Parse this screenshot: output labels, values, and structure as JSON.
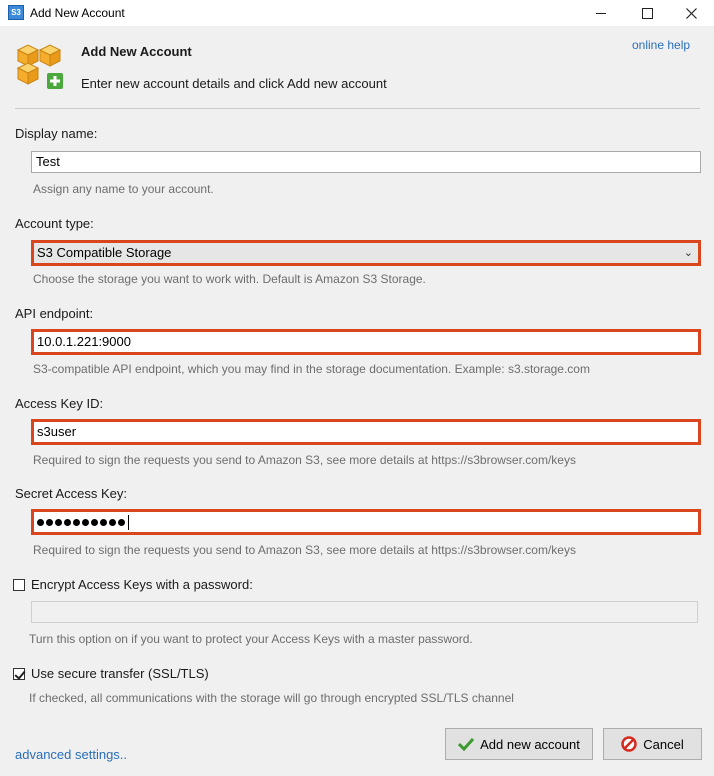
{
  "window": {
    "title": "Add New Account",
    "app_icon_text": "S3"
  },
  "header": {
    "title": "Add New Account",
    "subtitle": "Enter new account details and click Add new account",
    "help_link": "online help"
  },
  "display_name": {
    "label": "Display name:",
    "value": "Test",
    "hint": "Assign any name to your account."
  },
  "account_type": {
    "label": "Account type:",
    "value": "S3 Compatible Storage",
    "hint": "Choose the storage you want to work with. Default is Amazon S3 Storage."
  },
  "api_endpoint": {
    "label": "API endpoint:",
    "value": "10.0.1.221:9000",
    "hint": "S3-compatible API endpoint, which you may find in the storage documentation. Example: s3.storage.com"
  },
  "access_key": {
    "label": "Access Key ID:",
    "value": "s3user",
    "hint": "Required to sign the requests you send to Amazon S3, see more details at https://s3browser.com/keys"
  },
  "secret_key": {
    "label": "Secret Access Key:",
    "masked_length": 10,
    "hint": "Required to sign the requests you send to Amazon S3, see more details at https://s3browser.com/keys"
  },
  "encrypt": {
    "label": "Encrypt Access Keys with a password:",
    "checked": false,
    "hint": "Turn this option on if you want to protect your Access Keys with a master password."
  },
  "secure": {
    "label": "Use secure transfer (SSL/TLS)",
    "checked": true,
    "hint": "If checked, all communications with the storage will go through encrypted SSL/TLS channel"
  },
  "footer": {
    "advanced_link": "advanced settings..",
    "add_button": "Add new account",
    "cancel_button": "Cancel"
  },
  "colors": {
    "highlight": "#d9461e",
    "link": "#2a6fb8",
    "hint": "#6d6d6d"
  },
  "icons": [
    "s3-app-icon",
    "cubes-add-icon",
    "minimize-icon",
    "maximize-icon",
    "close-icon",
    "chevron-down-icon",
    "checkmark-icon",
    "cancel-icon"
  ]
}
